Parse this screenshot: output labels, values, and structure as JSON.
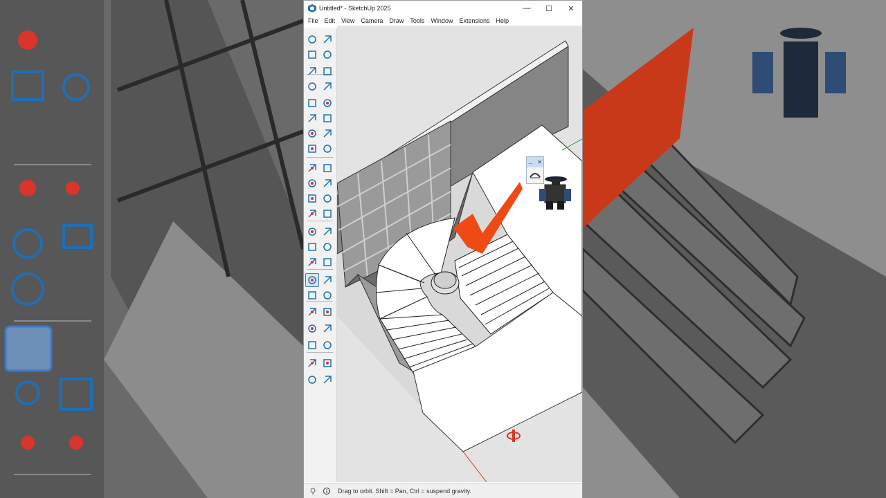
{
  "window": {
    "title": "Untitled* - SketchUp 2025",
    "minimize_glyph": "—",
    "maximize_glyph": "☐",
    "close_glyph": "✕"
  },
  "menu": [
    "File",
    "Edit",
    "View",
    "Camera",
    "Draw",
    "Tools",
    "Window",
    "Extensions",
    "Help"
  ],
  "toolbar": {
    "tools": [
      "select-icon",
      "lasso-icon",
      "paint-bucket-icon",
      "eraser-icon",
      "tag-icon",
      "eraser-alt-icon",
      "pencil-icon",
      "freehand-icon",
      "rectangle-icon",
      "rotated-rectangle-icon",
      "circle-icon",
      "polygon-icon",
      "line-icon",
      "arc-icon",
      "pie-icon",
      "two-point-arc-icon",
      "move-icon",
      "push-pull-icon",
      "rotate-icon",
      "follow-me-icon",
      "scale-icon",
      "offset-icon",
      "axes-icon",
      "section-plane-icon",
      "tape-measure-icon",
      "dimension-icon",
      "protractor-icon",
      "text-icon",
      "axes-position-icon",
      "3d-text-icon",
      "orbit-icon",
      "pan-icon",
      "zoom-icon",
      "zoom-window-icon",
      "zoom-extents-icon",
      "previous-view-icon",
      "position-camera-icon",
      "walk-icon",
      "look-around-icon",
      "section-display-icon",
      "warehouse-icon",
      "extension-warehouse-icon",
      "layers-icon",
      "scenes-icon"
    ],
    "active_tool": "orbit-icon"
  },
  "popup": {
    "head_label": "...",
    "close_glyph": "✕"
  },
  "status": {
    "text": "Drag to orbit. Shift = Pan, Ctrl = suspend gravity."
  },
  "colors": {
    "accent": "#e8401c",
    "tool_blue": "#1f6fb5",
    "tool_red": "#d9352a",
    "viewport_bg": "#e3e3e3",
    "wall": "#7d7d7d",
    "floor": "#ffffff",
    "checkmark": "#f04a14"
  }
}
